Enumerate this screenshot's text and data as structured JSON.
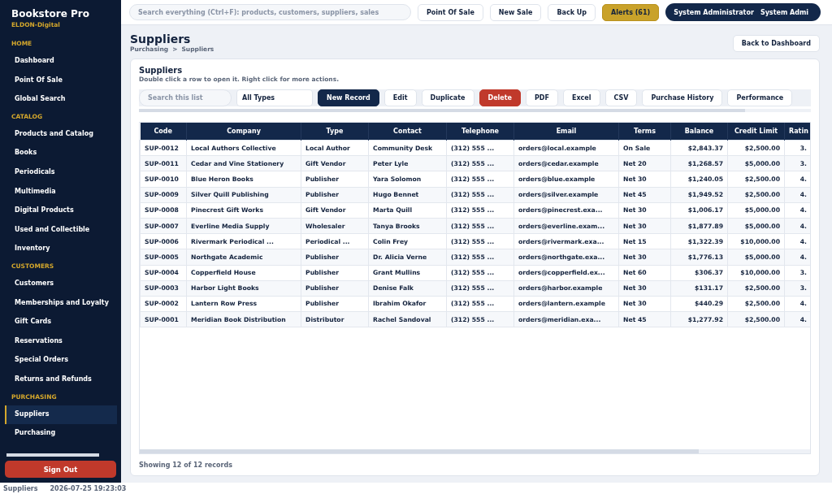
{
  "app": {
    "name": "Bookstore Pro",
    "tenant": "ELDON-Digital"
  },
  "sidebar": {
    "sections": [
      {
        "title": "HOME",
        "items": [
          {
            "label": "Dashboard",
            "selected": false
          },
          {
            "label": "Point Of Sale",
            "selected": false
          },
          {
            "label": "Global Search",
            "selected": false
          }
        ]
      },
      {
        "title": "CATALOG",
        "items": [
          {
            "label": "Products and Catalog",
            "selected": false
          },
          {
            "label": "Books",
            "selected": false
          },
          {
            "label": "Periodicals",
            "selected": false
          },
          {
            "label": "Multimedia",
            "selected": false
          },
          {
            "label": "Digital Products",
            "selected": false
          },
          {
            "label": "Used and Collectible",
            "selected": false
          },
          {
            "label": "Inventory",
            "selected": false
          }
        ]
      },
      {
        "title": "CUSTOMERS",
        "items": [
          {
            "label": "Customers",
            "selected": false
          },
          {
            "label": "Memberships and Loyalty",
            "selected": false
          },
          {
            "label": "Gift Cards",
            "selected": false
          },
          {
            "label": "Reservations",
            "selected": false
          },
          {
            "label": "Special Orders",
            "selected": false
          },
          {
            "label": "Returns and Refunds",
            "selected": false
          }
        ]
      },
      {
        "title": "PURCHASING",
        "items": [
          {
            "label": "Suppliers",
            "selected": true
          },
          {
            "label": "Purchasing",
            "selected": false
          }
        ]
      }
    ],
    "sign_out": "Sign Out"
  },
  "topbar": {
    "search": {
      "placeholder": "Search everything (Ctrl+F): products, customers, suppliers, sales"
    },
    "buttons": [
      {
        "label": "Point Of Sale",
        "kind": "plain"
      },
      {
        "label": "New Sale",
        "kind": "plain"
      },
      {
        "label": "Back Up",
        "kind": "plain"
      },
      {
        "label": "Alerts (61)",
        "kind": "alert"
      }
    ],
    "user": {
      "role": "System Administrator",
      "name": "System Admi"
    }
  },
  "page": {
    "title": "Suppliers",
    "breadcrumb": [
      "Purchasing",
      ">",
      "Suppliers"
    ],
    "back_button": "Back to Dashboard"
  },
  "card": {
    "title": "Suppliers",
    "hint": "Double click a row to open it. Right click for more actions.",
    "toolbar": {
      "search": {
        "placeholder": "Search this list"
      },
      "filter": "All Types",
      "buttons": [
        {
          "label": "New Record",
          "kind": "primary"
        },
        {
          "label": "Edit",
          "kind": "plain"
        },
        {
          "label": "Duplicate",
          "kind": "plain"
        },
        {
          "label": "Delete",
          "kind": "danger"
        },
        {
          "label": "PDF",
          "kind": "plain"
        },
        {
          "label": "Excel",
          "kind": "plain"
        },
        {
          "label": "CSV",
          "kind": "plain"
        },
        {
          "label": "Purchase History",
          "kind": "plain"
        },
        {
          "label": "Performance",
          "kind": "plain"
        }
      ]
    },
    "table": {
      "columns": [
        {
          "label": "Code",
          "kind": "text"
        },
        {
          "label": "Company",
          "kind": "text"
        },
        {
          "label": "Type",
          "kind": "text"
        },
        {
          "label": "Contact",
          "kind": "text"
        },
        {
          "label": "Telephone",
          "kind": "text"
        },
        {
          "label": "Email",
          "kind": "text"
        },
        {
          "label": "Terms",
          "kind": "text"
        },
        {
          "label": "Balance",
          "kind": "number"
        },
        {
          "label": "Credit Limit",
          "kind": "number"
        },
        {
          "label": "Ratin",
          "kind": "number"
        }
      ],
      "rows": [
        [
          "SUP-0012",
          "Local Authors Collective",
          "Local Author",
          "Community Desk",
          "(312) 555 ...",
          "orders@local.example",
          "On Sale",
          "$2,843.37",
          "$2,500.00",
          "3."
        ],
        [
          "SUP-0011",
          "Cedar and Vine Stationery",
          "Gift Vendor",
          "Peter Lyle",
          "(312) 555 ...",
          "orders@cedar.example",
          "Net 20",
          "$1,268.57",
          "$5,000.00",
          "3."
        ],
        [
          "SUP-0010",
          "Blue Heron Books",
          "Publisher",
          "Yara Solomon",
          "(312) 555 ...",
          "orders@blue.example",
          "Net 30",
          "$1,240.05",
          "$2,500.00",
          "4."
        ],
        [
          "SUP-0009",
          "Silver Quill Publishing",
          "Publisher",
          "Hugo Bennet",
          "(312) 555 ...",
          "orders@silver.example",
          "Net 45",
          "$1,949.52",
          "$2,500.00",
          "4."
        ],
        [
          "SUP-0008",
          "Pinecrest Gift Works",
          "Gift Vendor",
          "Marta Quill",
          "(312) 555 ...",
          "orders@pinecrest.exa...",
          "Net 30",
          "$1,006.17",
          "$5,000.00",
          "4."
        ],
        [
          "SUP-0007",
          "Everline Media Supply",
          "Wholesaler",
          "Tanya Brooks",
          "(312) 555 ...",
          "orders@everline.exam...",
          "Net 30",
          "$1,877.89",
          "$5,000.00",
          "4."
        ],
        [
          "SUP-0006",
          "Rivermark Periodical ...",
          "Periodical ...",
          "Colin Frey",
          "(312) 555 ...",
          "orders@rivermark.exa...",
          "Net 15",
          "$1,322.39",
          "$10,000.00",
          "4."
        ],
        [
          "SUP-0005",
          "Northgate Academic",
          "Publisher",
          "Dr. Alicia Verne",
          "(312) 555 ...",
          "orders@northgate.exa...",
          "Net 30",
          "$1,776.13",
          "$5,000.00",
          "4."
        ],
        [
          "SUP-0004",
          "Copperfield House",
          "Publisher",
          "Grant Mullins",
          "(312) 555 ...",
          "orders@copperfield.ex...",
          "Net 60",
          "$306.37",
          "$10,000.00",
          "3."
        ],
        [
          "SUP-0003",
          "Harbor Light Books",
          "Publisher",
          "Denise Falk",
          "(312) 555 ...",
          "orders@harbor.example",
          "Net 30",
          "$131.17",
          "$2,500.00",
          "3."
        ],
        [
          "SUP-0002",
          "Lantern Row Press",
          "Publisher",
          "Ibrahim Okafor",
          "(312) 555 ...",
          "orders@lantern.example",
          "Net 30",
          "$440.29",
          "$2,500.00",
          "4."
        ],
        [
          "SUP-0001",
          "Meridian Book Distribution",
          "Distributor",
          "Rachel Sandoval",
          "(312) 555 ...",
          "orders@meridian.exa...",
          "Net 45",
          "$1,277.92",
          "$2,500.00",
          "4."
        ]
      ]
    },
    "footer": "Showing 12 of 12 records"
  },
  "status_bar": {
    "page": "Suppliers",
    "timestamp": "2026-07-25 19:23:03"
  }
}
